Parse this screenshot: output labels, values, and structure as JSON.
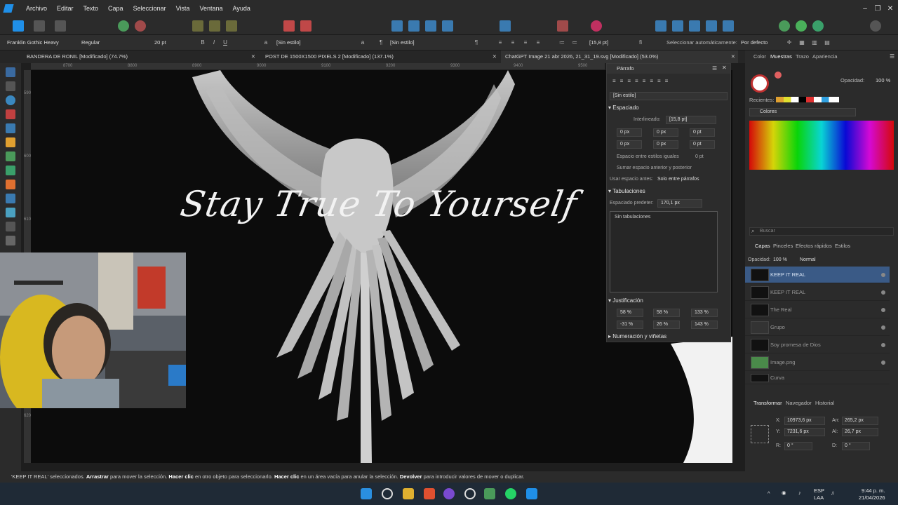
{
  "menubar": {
    "items": [
      "Archivo",
      "Editar",
      "Texto",
      "Capa",
      "Seleccionar",
      "Vista",
      "Ventana",
      "Ayuda"
    ],
    "window_controls": [
      "–",
      "❐",
      "✕"
    ]
  },
  "context_bar": {
    "font_family": "Franklin Gothic Heavy",
    "font_style": "Regular",
    "font_size": "20 pt",
    "char_style": "[Sin estilo]",
    "para_style": "[Sin estilo]",
    "leading": "[15,8 pt]",
    "auto_select_label": "Seleccionar automáticamente:",
    "auto_select_value": "Por defecto"
  },
  "doc_tabs": [
    {
      "label": "BANDERA DE RONIL [Modificado] (74.7%)"
    },
    {
      "label": "POST DE 1500X1500 PIXELS 2 [Modificado] (137.1%)"
    },
    {
      "label": "ChatGPT Image 21 abr 2026, 21_31_19.svg [Modificado] (53.0%)"
    }
  ],
  "ruler": {
    "top_marks": [
      "8700",
      "8800",
      "8900",
      "9000",
      "9100",
      "9200",
      "9300",
      "9400",
      "9500"
    ],
    "left_marks": [
      "5900",
      "6000",
      "6100",
      "6200"
    ]
  },
  "canvas": {
    "text": "Stay True To Yourself"
  },
  "paragraph_panel": {
    "title": "Párrafo",
    "style": "[Sin estilo]",
    "spacing_header": "Espaciado",
    "interlineado_label": "Interlineado:",
    "interlineado_value": "[15,8 pt]",
    "indent_values": [
      "0 px",
      "0 px",
      "0 pt",
      "0 px",
      "0 px",
      "0 pt"
    ],
    "same_style_spacing": "Espacio entre estilos iguales",
    "same_style_value": "0 pt",
    "add_spacing": "Sumar espacio anterior y posterior",
    "use_space_label": "Usar espacio antes:",
    "use_space_value": "Solo entre párrafos",
    "tabs_header": "Tabulaciones",
    "default_spacing_label": "Espaciado predeter:",
    "default_spacing_value": "170,1 px",
    "no_tabs": "Sin tabulaciones",
    "justification_header": "Justificación",
    "justification_values": [
      "58 %",
      "58 %",
      "133 %",
      "-31 %",
      "26 %",
      "143 %"
    ],
    "numbering_header": "Numeración y viñetas"
  },
  "right_panel": {
    "top_tabs": [
      "Color",
      "Muestras",
      "Trazo",
      "Apariencia"
    ],
    "opacity_label": "Opacidad:",
    "opacity_value": "100 %",
    "recent_label": "Recientes:",
    "palette_label": "Colores",
    "search_placeholder": "Buscar",
    "layer_tabs": [
      "Capas",
      "Pinceles",
      "Efectos rápidos",
      "Estilos"
    ],
    "layer_opacity_label": "Opacidad:",
    "layer_opacity_value": "100 %",
    "blend_mode": "Normal",
    "layers": [
      {
        "name": "KEEP   IT   REAL",
        "selected": true
      },
      {
        "name": "KEEP   IT   REAL",
        "selected": false
      },
      {
        "name": "The Real",
        "selected": false
      },
      {
        "name": "Grupo",
        "selected": false
      },
      {
        "name": "Soy promesa de Dios",
        "selected": false
      },
      {
        "name": "Image.png",
        "selected": false
      },
      {
        "name": "Curva",
        "selected": false
      }
    ],
    "transform_tabs": [
      "Transformar",
      "Navegador",
      "Historial"
    ],
    "transform": {
      "x_label": "X:",
      "x_value": "10973,6 px",
      "y_label": "Y:",
      "y_value": "7231,6 px",
      "w_label": "An:",
      "w_value": "265,2 px",
      "h_label": "Al:",
      "h_value": "26,7 px",
      "r_label": "R:",
      "r_value": "0 °",
      "s_label": "D:",
      "s_value": "0 °"
    }
  },
  "status": {
    "sel": "'KEEP   IT   REAL' seleccionados.",
    "b1": "Arrastrar",
    "t1": " para mover la selección. ",
    "b2": "Hacer clic",
    "t2": " en otro objeto para seleccionarlo. ",
    "b3": "Hacer clic",
    "t3": " en un área vacía para anular la selección. ",
    "b4": "Devolver",
    "t4": " para introducir valores de mover o duplicar."
  },
  "taskbar": {
    "lang_top": "ESP",
    "lang_bottom": "LAA",
    "time": "9:44 p. m.",
    "date": "21/04/2026"
  },
  "colors": {
    "accent": "#1f8fe8",
    "selection": "#3a5a86"
  }
}
